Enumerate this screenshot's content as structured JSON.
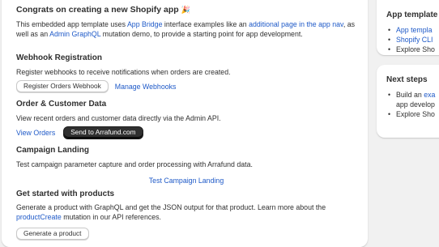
{
  "main": {
    "intro": {
      "title": "Congrats on creating a new Shopify app",
      "emoji": "🎉",
      "text_1": "This embedded app template uses ",
      "link_1": "App Bridge",
      "text_2": " interface examples like an ",
      "link_2": "additional page in the app nav",
      "text_3": ", as well as an ",
      "link_3": "Admin GraphQL",
      "text_4": " mutation demo, to provide a starting point for app development."
    },
    "webhook": {
      "title": "Webhook Registration",
      "description": "Register webhooks to receive notifications when orders are created.",
      "register_button": "Register Orders Webhook",
      "manage_link": "Manage Webhooks"
    },
    "orders": {
      "title": "Order & Customer Data",
      "description": "View recent orders and customer data directly via the Admin API.",
      "view_link": "View Orders",
      "send_button": "Send to Arrafund.com"
    },
    "campaign": {
      "title": "Campaign Landing",
      "description": "Test campaign parameter capture and order processing with Arrafund data.",
      "test_link": "Test Campaign Landing"
    },
    "products": {
      "title": "Get started with products",
      "text_1": "Generate a product with GraphQL and get the JSON output for that product. Learn more about the ",
      "link": "productCreate",
      "text_2": " mutation in our API references.",
      "generate_button": "Generate a product"
    }
  },
  "sidebar": {
    "app_template": {
      "title": "App template",
      "items": [
        "App templa",
        "Shopify CLI",
        "Explore Sho"
      ]
    },
    "next_steps": {
      "title": "Next steps",
      "item_1_prefix": "Build an ",
      "item_1_link": "exa",
      "item_1_line2": "app develop",
      "item_2": "Explore Sho"
    }
  },
  "colors": {
    "background": "#f1f1f1",
    "card": "#ffffff",
    "link": "#1f5ac8",
    "primary_button": "#303030",
    "text": "#303030"
  }
}
